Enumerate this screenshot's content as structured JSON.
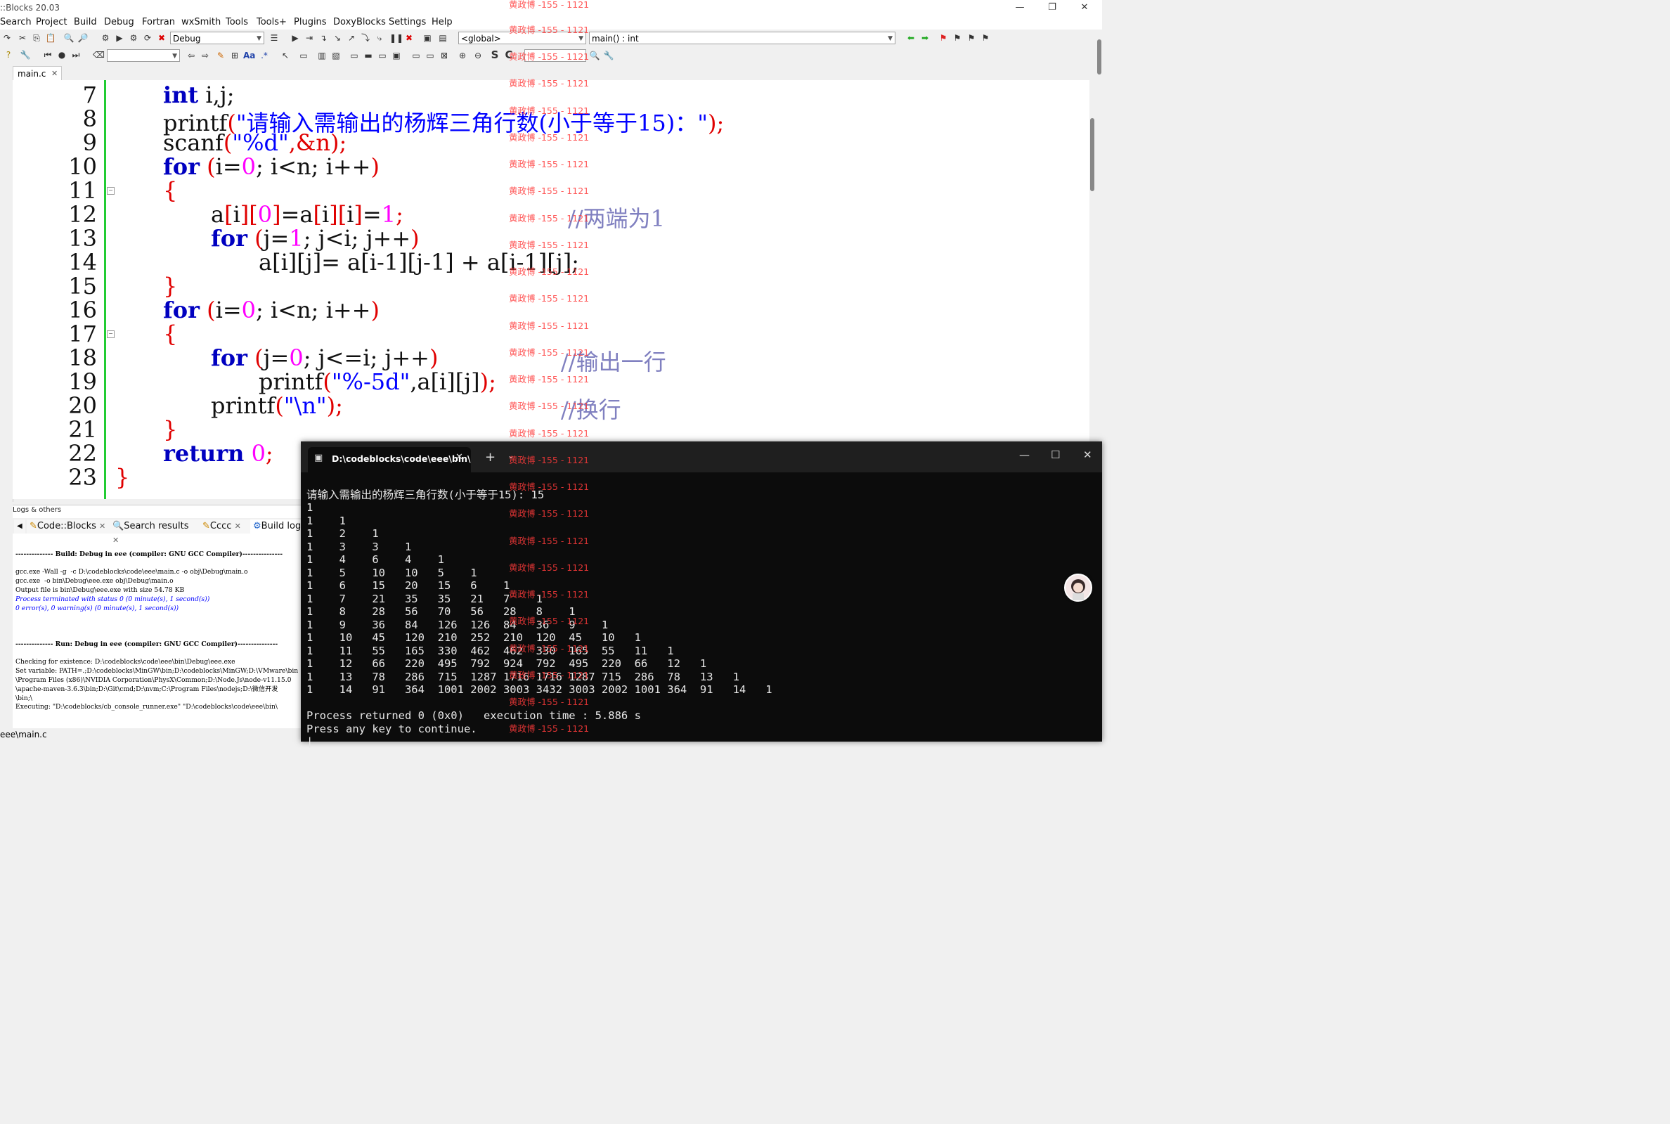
{
  "window": {
    "title": "::Blocks 20.03"
  },
  "menu": [
    "Search",
    "Project",
    "Build",
    "Debug",
    "Fortran",
    "wxSmith",
    "Tools",
    "Tools+",
    "Plugins",
    "DoxyBlocks",
    "Settings",
    "Help"
  ],
  "toolbar": {
    "build_target": "Debug",
    "scope": "<global>",
    "function": "main() : int"
  },
  "editor": {
    "tab": "main.c",
    "line_numbers": [
      "7",
      "8",
      "9",
      "10",
      "11",
      "12",
      "13",
      "14",
      "15",
      "16",
      "17",
      "18",
      "19",
      "20",
      "21",
      "22",
      "23"
    ],
    "lines": {
      "l7_kw": "int",
      " l7_rest": "",
      "l7": " i,j;",
      "l8_fn": "printf",
      "l8_str": "\"请输入需输出的杨辉三角行数(小于等于15)：\"",
      "l9_fn": "scanf",
      "l9_str": "\"%d\"",
      "l9_rest": ",&n",
      "for": "for",
      "l10_a": "i=",
      "l10_num": "0",
      "l10_b": "; i<n; i++",
      "l12_a": "a",
      "l12_b": "i",
      "l12_n0": "0",
      "l12_c": "=a",
      "l12_n1": "1",
      "l12_cmt": "//两端为1",
      "l13_a": "j=",
      "l13_num": "1",
      "l13_b": "; j<i; j++",
      "l14": "a[i][j]= a[i-1][j-1] + a[i-1][j];",
      "l16_a": "i=",
      "l16_num": "0",
      "l16_b": "; i<n; i++",
      "l18_a": "j=",
      "l18_num": "0",
      "l18_b": "; j<=i; j++",
      "l18_cmt": "//输出一行",
      "l19_fn": "printf",
      "l19_str": "\"%-5d\"",
      "l19_rest": ",a[i][j]",
      "l20_fn": "printf",
      "l20_str": "\"\\n\"",
      "l20_cmt": "//换行",
      "ret": "return",
      "ret_num": "0"
    }
  },
  "logs": {
    "title": "Logs & others",
    "tabs": [
      "Code::Blocks",
      "Search results",
      "Cccc",
      "Build log"
    ],
    "lines": [
      "-------------- Build: Debug in eee (compiler: GNU GCC Compiler)---------------",
      "",
      "gcc.exe -Wall -g  -c D:\\codeblocks\\code\\eee\\main.c -o obj\\Debug\\main.o",
      "gcc.exe  -o bin\\Debug\\eee.exe obj\\Debug\\main.o",
      "Output file is bin\\Debug\\eee.exe with size 54.78 KB",
      "Process terminated with status 0 (0 minute(s), 1 second(s))",
      "0 error(s), 0 warning(s) (0 minute(s), 1 second(s))",
      "",
      "",
      "",
      "-------------- Run: Debug in eee (compiler: GNU GCC Compiler)---------------",
      "",
      "Checking for existence: D:\\codeblocks\\code\\eee\\bin\\Debug\\eee.exe",
      "Set variable: PATH=.;D:\\codeblocks\\MinGW\\bin;D:\\codeblocks\\MinGW;D:\\VMware\\bin",
      "\\Program Files (x86)\\NVIDIA Corporation\\PhysX\\Common;D:\\Node.Js\\node-v11.15.0",
      "\\apache-maven-3.6.3\\bin;D:\\Git\\cmd;D:\\nvm;C:\\Program Files\\nodejs;D:\\微信开发",
      "\\bin;\\",
      "Executing: \"D:\\codeblocks/cb_console_runner.exe\" \"D:\\codeblocks\\code\\eee\\bin\\"
    ],
    "status": "eee\\main.c"
  },
  "console": {
    "tab_title": "D:\\codeblocks\\code\\eee\\bin\\",
    "prompt": "请输入需输出的杨辉三角行数(小于等于15): 15",
    "rows": [
      "1",
      "1    1",
      "1    2    1",
      "1    3    3    1",
      "1    4    6    4    1",
      "1    5    10   10   5    1",
      "1    6    15   20   15   6    1",
      "1    7    21   35   35   21   7    1",
      "1    8    28   56   70   56   28   8    1",
      "1    9    36   84   126  126  84   36   9    1",
      "1    10   45   120  210  252  210  120  45   10   1",
      "1    11   55   165  330  462  462  330  165  55   11   1",
      "1    12   66   220  495  792  924  792  495  220  66   12   1",
      "1    13   78   286  715  1287 1716 1716 1287 715  286  78   13   1",
      "1    14   91   364  1001 2002 3003 3432 3003 2002 1001 364  91   14   1"
    ],
    "returned": "Process returned 0 (0x0)   execution time : 5.886 s",
    "press": "Press any key to continue."
  },
  "watermark": "黄政博 -155 - 1121"
}
